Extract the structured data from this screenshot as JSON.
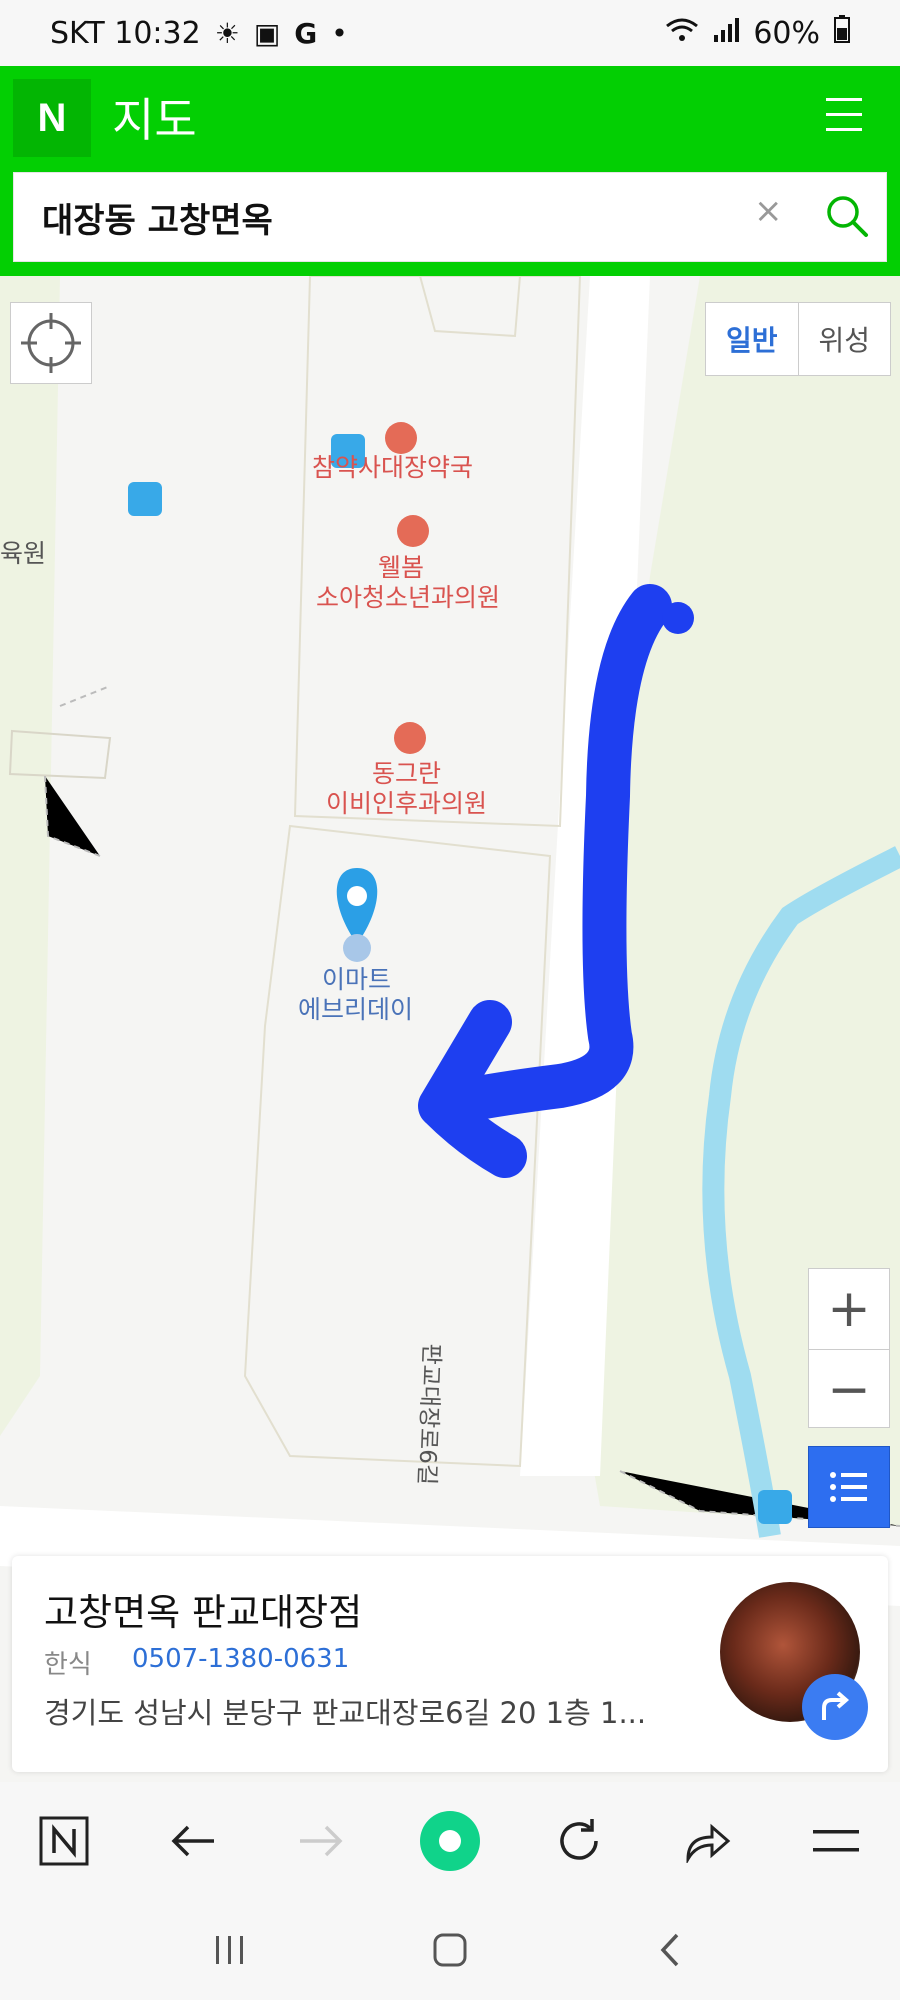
{
  "status_bar": {
    "carrier_time": "SKT 10:32",
    "battery": "60%"
  },
  "header": {
    "logo": "N",
    "title": "지도"
  },
  "search": {
    "query": "대장동 고창면옥",
    "clear_icon": "×"
  },
  "map": {
    "type_toggle": {
      "normal": "일반",
      "satellite": "위성"
    },
    "pois": {
      "pharmacy": "참약사대장약국",
      "clinic1_line1": "웰봄",
      "clinic1_line2": "소아청소년과의원",
      "clinic2_line1": "동그란",
      "clinic2_line2": "이비인후과의원",
      "mart_line1": "이마트",
      "mart_line2": "에브리데이",
      "left_edge": "육원",
      "road": "판교대장로6길"
    },
    "zoom": {
      "in": "+",
      "out": "−"
    }
  },
  "place_card": {
    "name": "고창면옥 판교대장점",
    "category": "한식",
    "phone": "0507-1380-0631",
    "address": "경기도 성남시 분당구 판교대장로6길 20 1층 1..."
  },
  "colors": {
    "naver_green": "#03cf03",
    "accent_blue": "#2d6ef0",
    "annotation_blue": "#1e3ff0"
  }
}
